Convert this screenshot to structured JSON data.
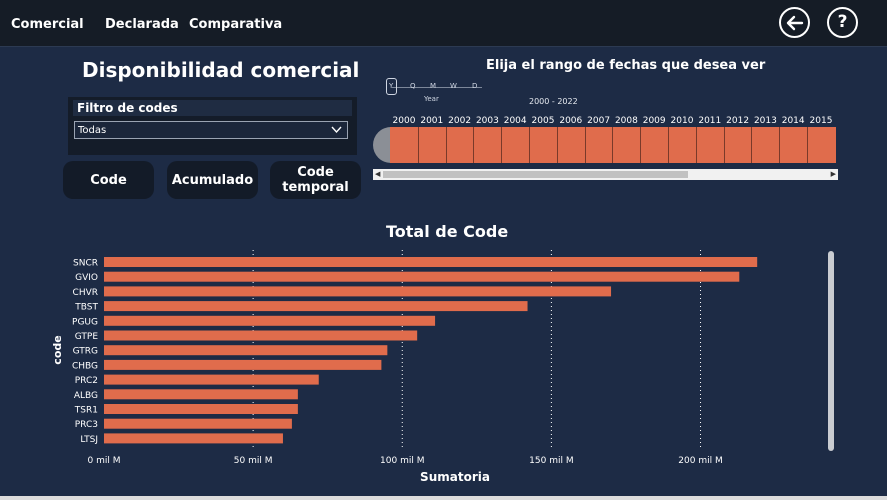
{
  "nav": {
    "items": [
      "Comercial",
      "Declarada",
      "Comparativa"
    ]
  },
  "icons": {
    "back": "arrow-left-icon",
    "help": "question-mark-icon"
  },
  "page_title": "Disponibilidad comercial",
  "filter": {
    "header": "Filtro de codes",
    "selected": "Todas"
  },
  "buttons": [
    "Code",
    "Acumulado",
    "Code temporal"
  ],
  "timeline": {
    "title": "Elija el rango de fechas que desea ver",
    "granularities": [
      "Y",
      "Q",
      "M",
      "W",
      "D"
    ],
    "granularity_label": "Year",
    "range": "2000 - 2022",
    "years": [
      "2000",
      "2001",
      "2002",
      "2003",
      "2004",
      "2005",
      "2006",
      "2007",
      "2008",
      "2009",
      "2010",
      "2011",
      "2012",
      "2013",
      "2014",
      "2015"
    ]
  },
  "colors": {
    "bar": "#e06c4c",
    "background": "#1d2b45",
    "topbar": "#151c26"
  },
  "chart_data": {
    "type": "bar",
    "orientation": "horizontal",
    "title": "Total de Code",
    "xlabel": "Sumatoria",
    "ylabel": "code",
    "categories": [
      "SNCR",
      "GVIO",
      "CHVR",
      "TBST",
      "PGUG",
      "GTPE",
      "GTRG",
      "CHBG",
      "PRC2",
      "ALBG",
      "TSR1",
      "PRC3",
      "LTSJ"
    ],
    "values": [
      219,
      213,
      170,
      142,
      111,
      105,
      95,
      93,
      72,
      65,
      65,
      63,
      60
    ],
    "xlim": [
      0,
      230
    ],
    "xticks": [
      0,
      50,
      100,
      150,
      200
    ],
    "xtick_labels": [
      "0 mil M",
      "50 mil M",
      "100 mil M",
      "150 mil M",
      "200 mil M"
    ],
    "grid": "vertical-dotted"
  }
}
